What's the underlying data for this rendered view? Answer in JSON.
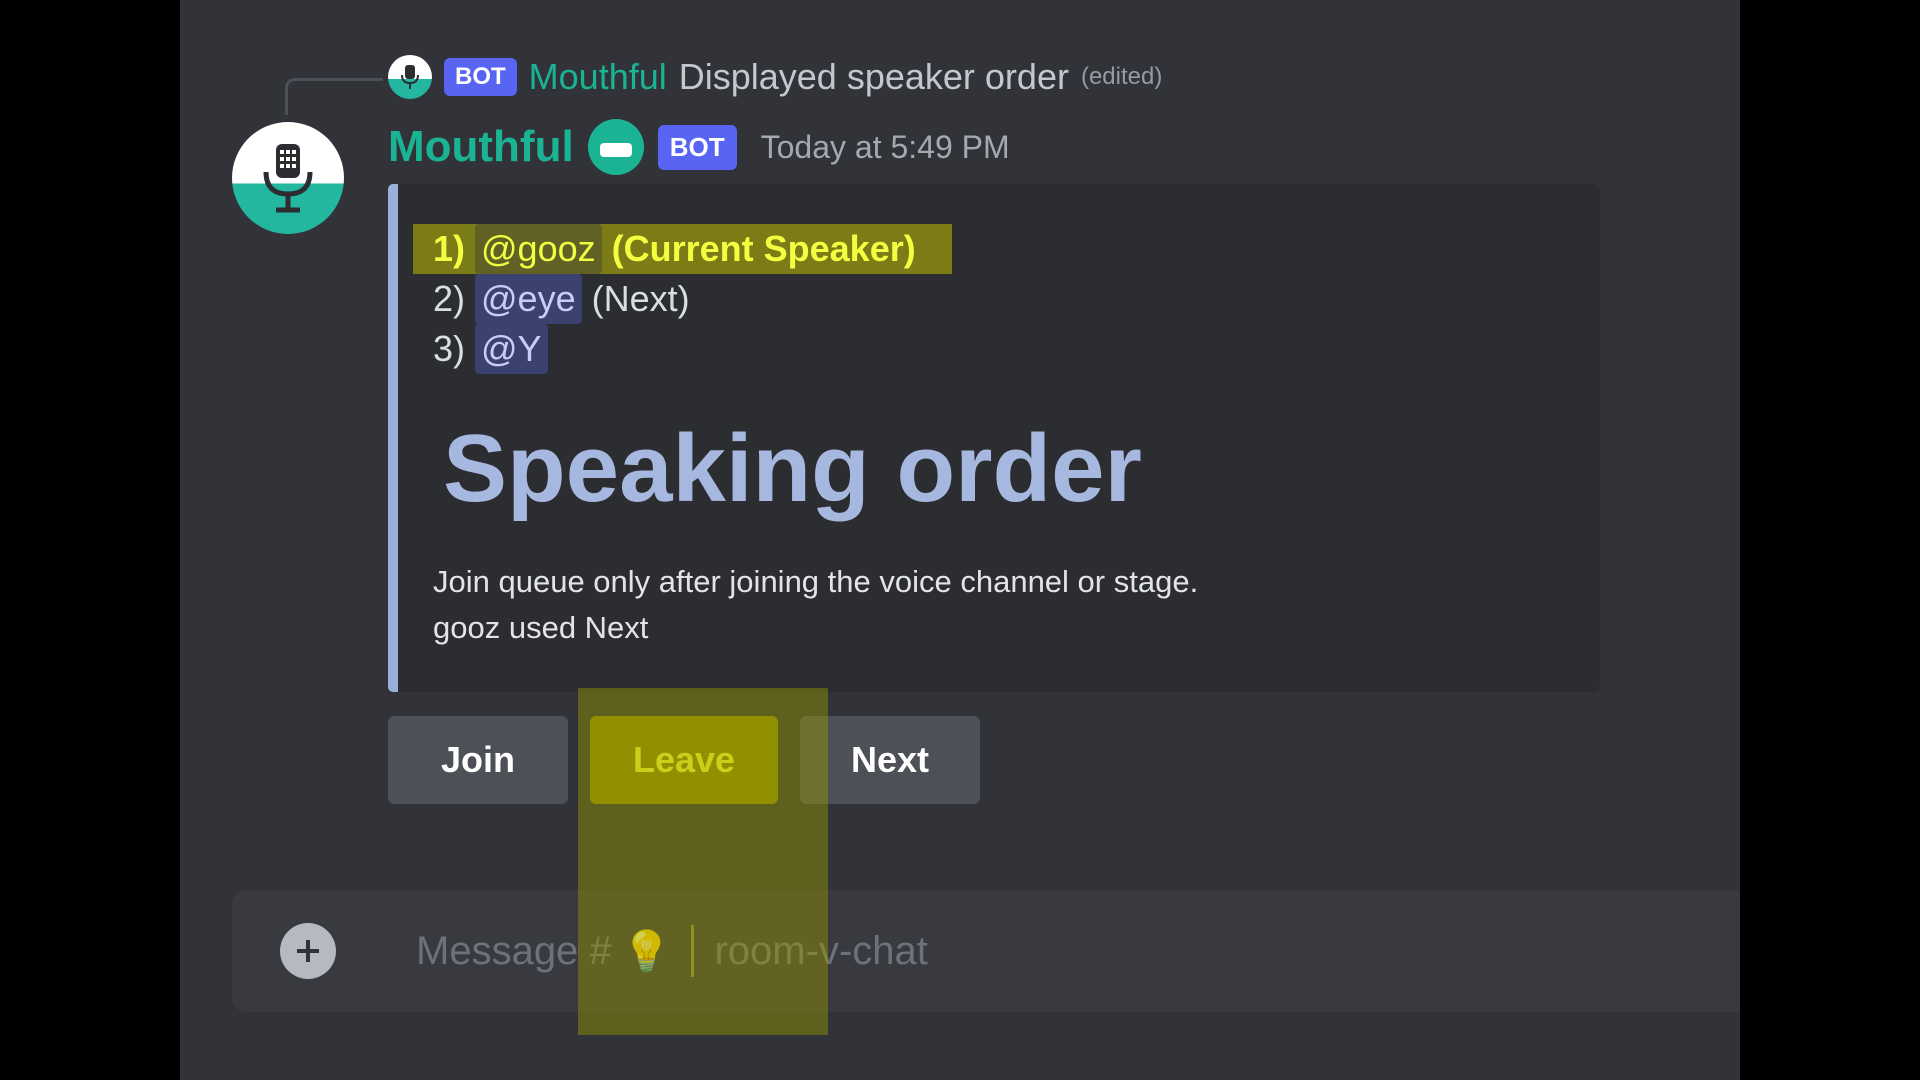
{
  "reply": {
    "bot_tag": "BOT",
    "author": "Mouthful",
    "text": "Displayed speaker order",
    "edited": "(edited)"
  },
  "message": {
    "author": "Mouthful",
    "bot_tag": "BOT",
    "timestamp": "Today at 5:49 PM"
  },
  "embed": {
    "queue": [
      {
        "num": "1)",
        "mention": "@gooz",
        "note": "(Current Speaker)"
      },
      {
        "num": "2)",
        "mention": "@eye",
        "note": "(Next)"
      },
      {
        "num": "3)",
        "mention": "@Y",
        "note": ""
      }
    ],
    "title": "Speaking order",
    "description_line1": "Join queue only after joining the voice channel or stage.",
    "description_line2": "gooz used Next"
  },
  "buttons": {
    "join": "Join",
    "leave": "Leave",
    "next": "Next"
  },
  "composer": {
    "placeholder_prefix": "Message #",
    "channel_suffix": "room-v-chat"
  },
  "colors": {
    "accent_teal": "#1ab394",
    "bot_tag": "#5865f2",
    "highlight": "#f0ff40"
  }
}
